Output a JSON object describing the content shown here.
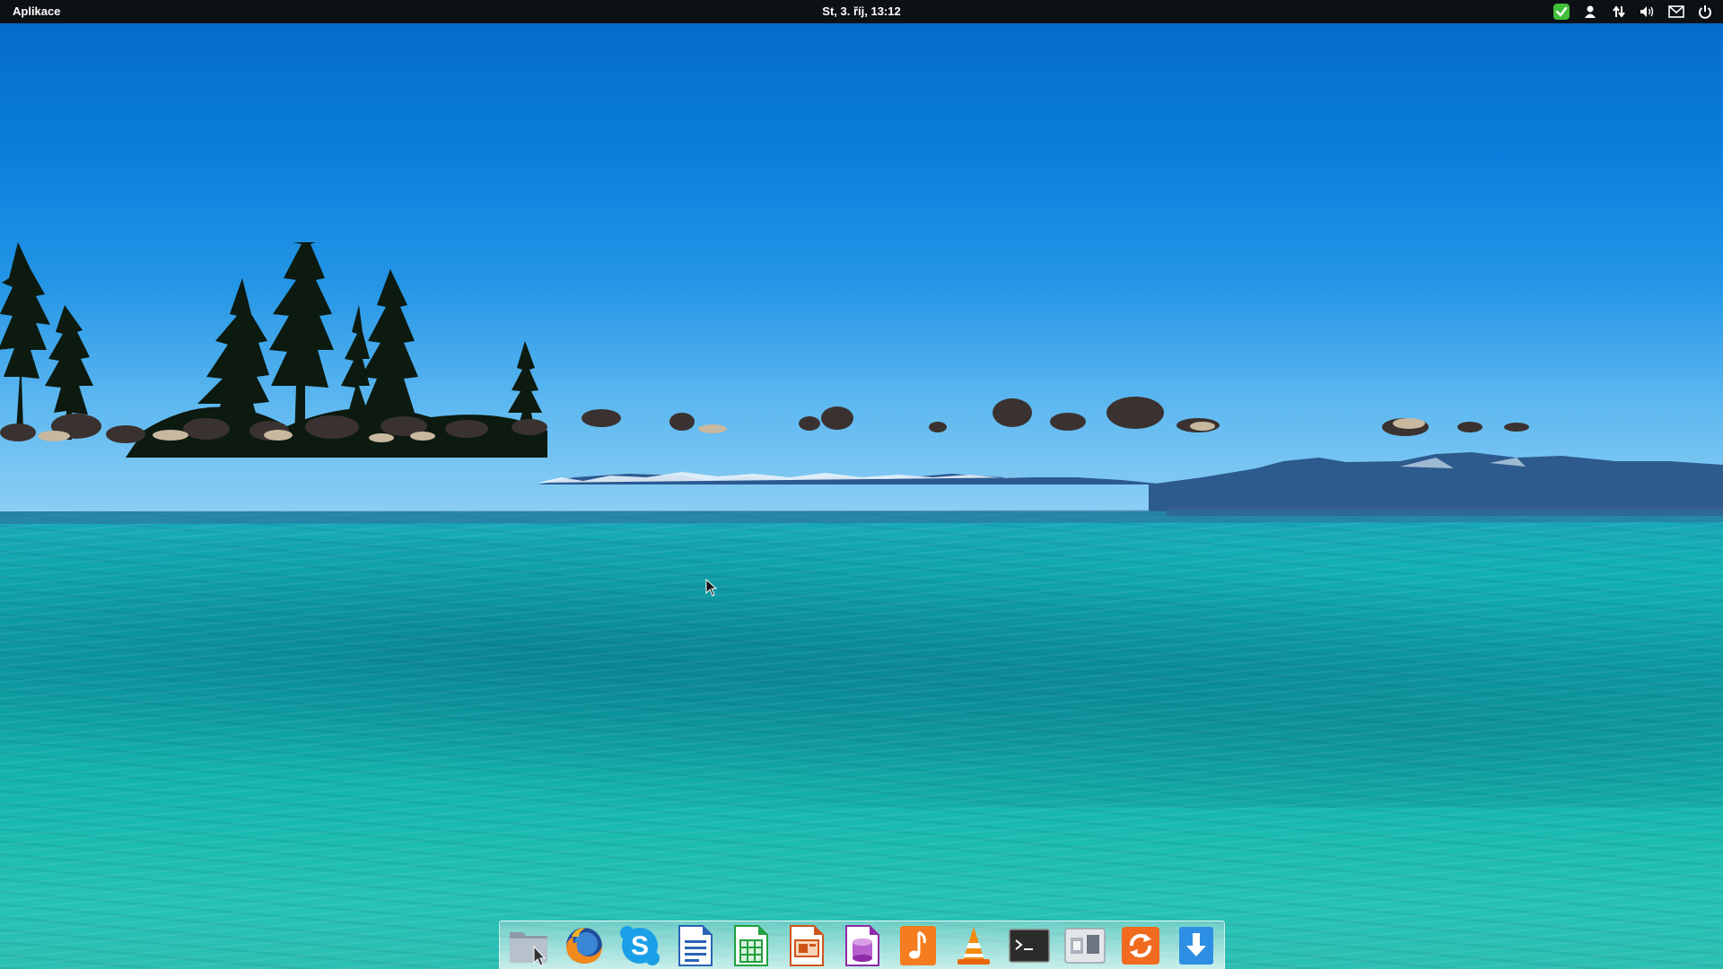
{
  "top_panel": {
    "applications_label": "Aplikace",
    "clock": "St, 3. říj, 13:12",
    "indicators": [
      {
        "icon": "update-shield-icon",
        "color": "#3fbf3a"
      },
      {
        "icon": "user-icon"
      },
      {
        "icon": "network-icon"
      },
      {
        "icon": "volume-icon"
      },
      {
        "icon": "mail-icon"
      },
      {
        "icon": "power-icon"
      }
    ]
  },
  "wallpaper": {
    "description_colors": {
      "sky_top": "#0468c9",
      "sky_horizon": "#8fd0f4",
      "water": "#13b0b4"
    }
  },
  "dock": {
    "items": [
      {
        "icon": "files-icon",
        "app": "Files"
      },
      {
        "icon": "firefox-icon",
        "app": "Firefox"
      },
      {
        "icon": "skype-icon",
        "app": "Skype"
      },
      {
        "icon": "libreoffice-writer-icon",
        "app": "LibreOffice Writer"
      },
      {
        "icon": "libreoffice-calc-icon",
        "app": "LibreOffice Calc"
      },
      {
        "icon": "libreoffice-impress-icon",
        "app": "LibreOffice Impress"
      },
      {
        "icon": "libreoffice-base-icon",
        "app": "LibreOffice Base"
      },
      {
        "icon": "music-icon",
        "app": "Music"
      },
      {
        "icon": "vlc-icon",
        "app": "VLC"
      },
      {
        "icon": "terminal-icon",
        "app": "Terminal"
      },
      {
        "icon": "system-settings-icon",
        "app": "System Settings"
      },
      {
        "icon": "software-update-icon",
        "app": "Software Updater"
      },
      {
        "icon": "download-icon",
        "app": "Downloads"
      }
    ]
  }
}
